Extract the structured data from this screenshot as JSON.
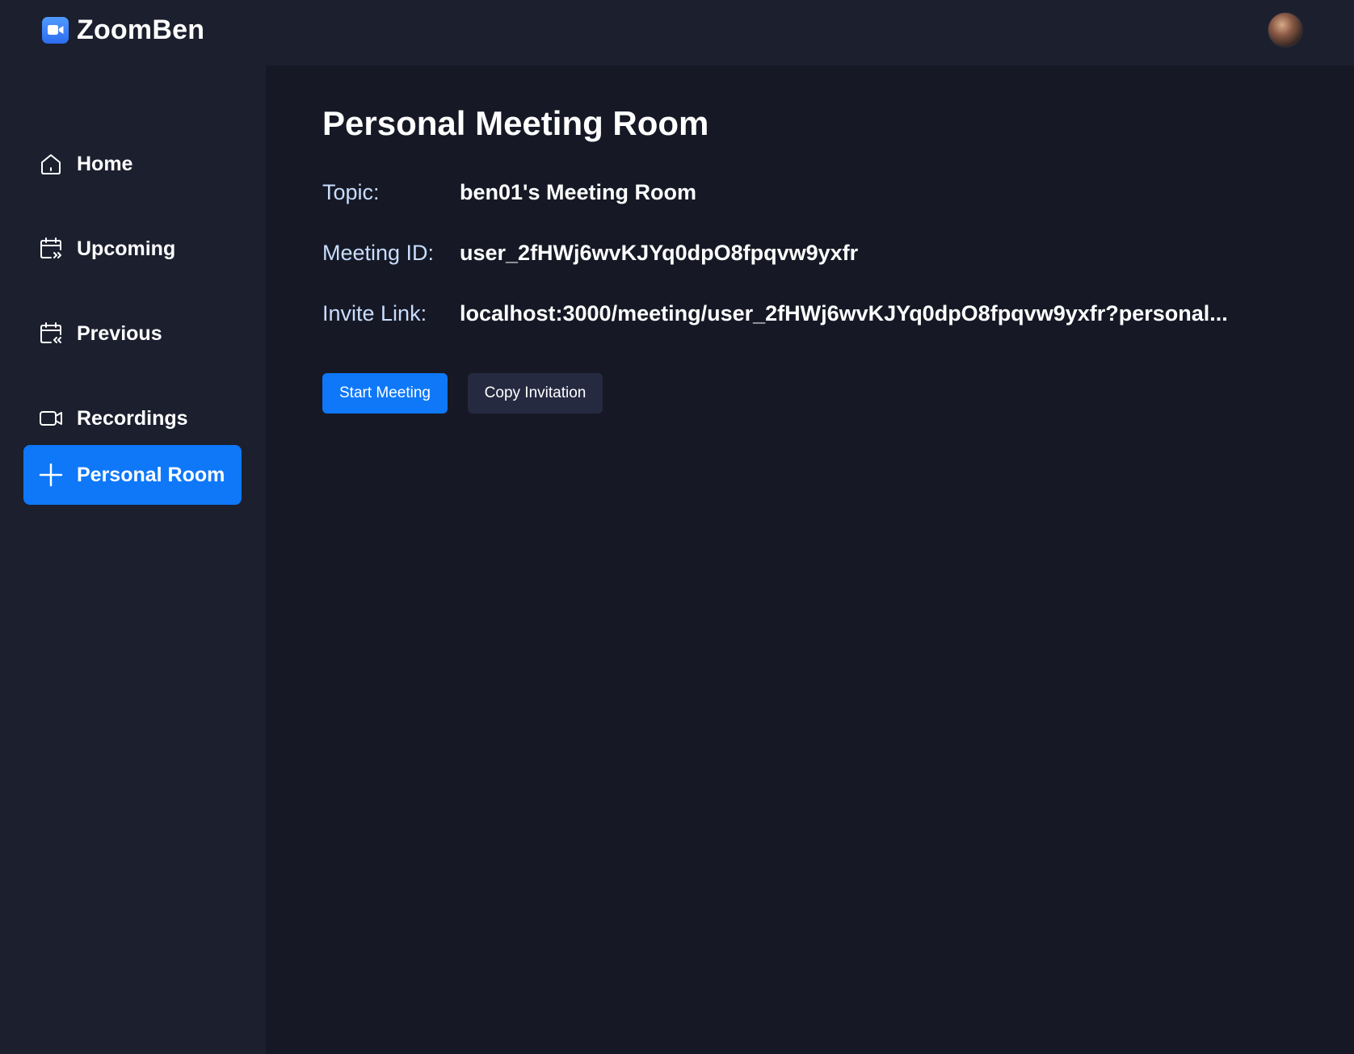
{
  "brand": {
    "name": "ZoomBen"
  },
  "sidebar": {
    "items": [
      {
        "label": "Home",
        "icon": "home-icon",
        "active": false
      },
      {
        "label": "Upcoming",
        "icon": "calendar-upcoming-icon",
        "active": false
      },
      {
        "label": "Previous",
        "icon": "calendar-previous-icon",
        "active": false
      },
      {
        "label": "Recordings",
        "icon": "video-icon",
        "active": false
      },
      {
        "label": "Personal Room",
        "icon": "plus-icon",
        "active": true
      }
    ]
  },
  "main": {
    "title": "Personal Meeting Room",
    "details": [
      {
        "key": "Topic:",
        "value": "ben01's Meeting Room"
      },
      {
        "key": "Meeting ID:",
        "value": "user_2fHWj6wvKJYq0dpO8fpqvw9yxfr"
      },
      {
        "key": "Invite Link:",
        "value": "localhost:3000/meeting/user_2fHWj6wvKJYq0dpO8fpqvw9yxfr?personal..."
      }
    ],
    "buttons": {
      "start": "Start Meeting",
      "copy": "Copy Invitation"
    }
  },
  "colors": {
    "background": "#161925",
    "panel": "#1c1f2e",
    "accent": "#0e78f9",
    "secondary_button": "#252a41",
    "label_text": "#c9ddff"
  }
}
